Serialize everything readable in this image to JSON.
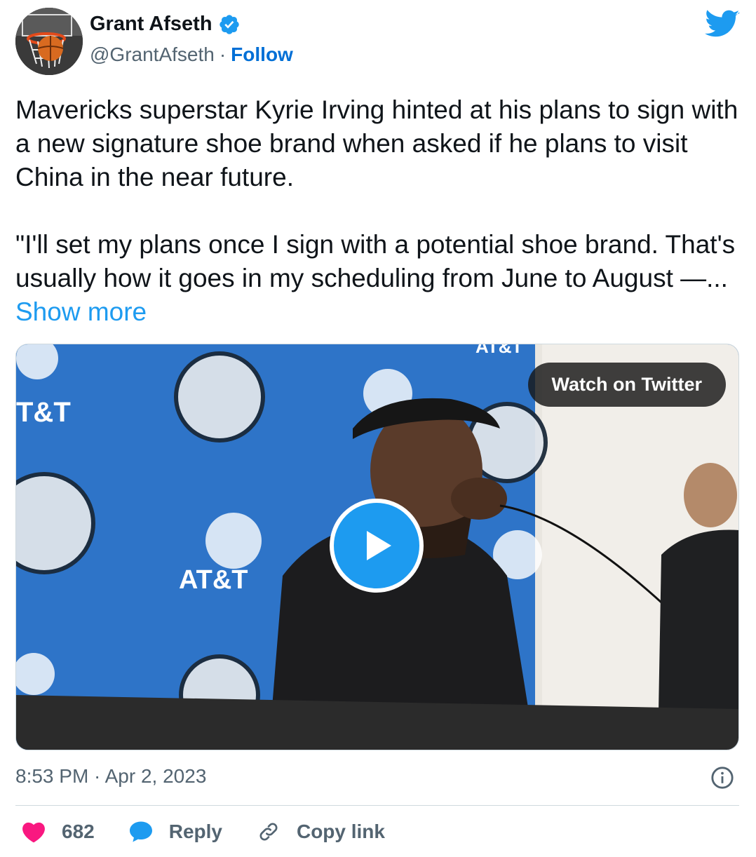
{
  "author": {
    "name": "Grant Afseth",
    "handle": "@GrantAfseth",
    "separator": "·",
    "follow_label": "Follow"
  },
  "tweet": {
    "text": "Mavericks superstar Kyrie Irving hinted at his plans to sign with a new signature shoe brand when asked if he plans to visit China in the near future.\n\n\"I'll set my plans once I sign with a potential shoe brand. That's usually how it goes in my scheduling from June to August —... ",
    "show_more_label": "Show more"
  },
  "media": {
    "watch_label": "Watch on Twitter",
    "backdrop_texts": [
      "T&T",
      "AT&T",
      "AT&T"
    ]
  },
  "meta": {
    "timestamp": "8:53 PM · Apr 2, 2023"
  },
  "actions": {
    "like_count": "682",
    "reply_label": "Reply",
    "copy_label": "Copy link"
  },
  "colors": {
    "accent": "#1d9bf0",
    "follow": "#006fd6",
    "like": "#f91880",
    "secondary_text": "#536471",
    "backdrop_blue": "#2a6fc0"
  },
  "icons": [
    "avatar",
    "verified-badge-icon",
    "twitter-bird-icon",
    "play-icon",
    "info-icon",
    "heart-icon",
    "reply-bubble-icon",
    "link-icon"
  ]
}
